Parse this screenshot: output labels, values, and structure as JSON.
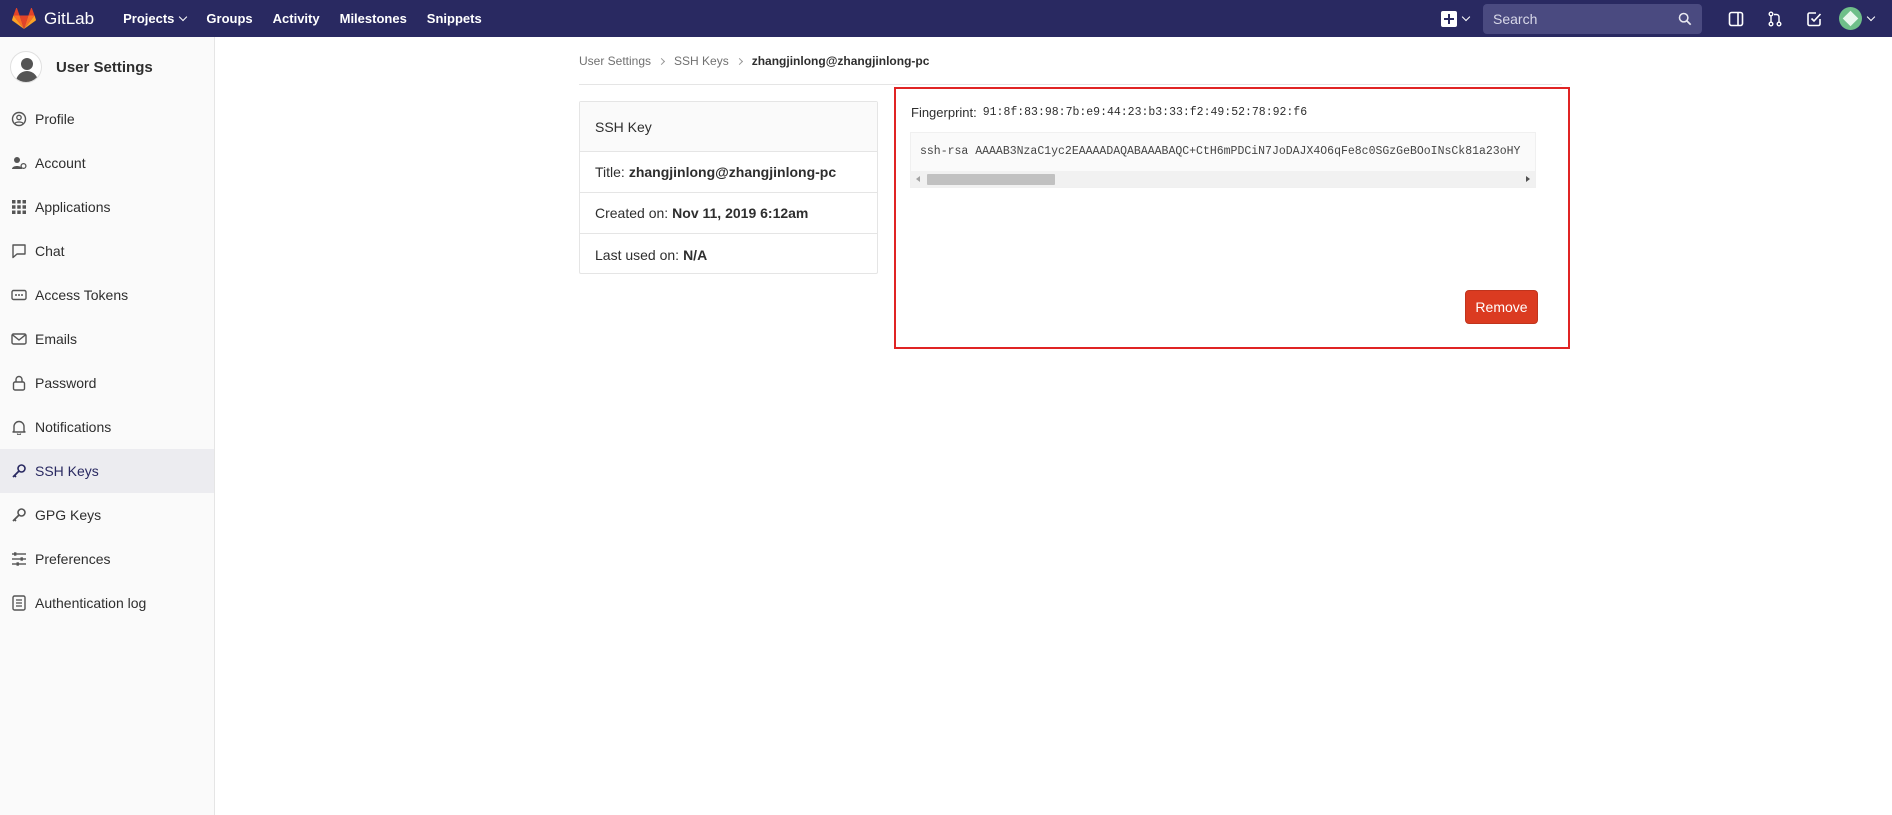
{
  "app": {
    "brand": "GitLab",
    "accent_color": "#292961",
    "danger_color": "#db3b21",
    "highlight_color": "#e02424"
  },
  "navbar": {
    "links": [
      {
        "label": "Projects",
        "has_dropdown": true
      },
      {
        "label": "Groups"
      },
      {
        "label": "Activity"
      },
      {
        "label": "Milestones"
      },
      {
        "label": "Snippets"
      }
    ],
    "search_placeholder": "Search",
    "icons": [
      "plus-icon",
      "search-icon",
      "sidebar-toggle-icon",
      "merge-request-icon",
      "todo-check-icon",
      "user-avatar"
    ]
  },
  "sidebar": {
    "title": "User Settings",
    "items": [
      {
        "label": "Profile",
        "icon": "profile-icon"
      },
      {
        "label": "Account",
        "icon": "account-icon"
      },
      {
        "label": "Applications",
        "icon": "applications-icon"
      },
      {
        "label": "Chat",
        "icon": "chat-icon"
      },
      {
        "label": "Access Tokens",
        "icon": "access-tokens-icon"
      },
      {
        "label": "Emails",
        "icon": "email-icon"
      },
      {
        "label": "Password",
        "icon": "lock-icon"
      },
      {
        "label": "Notifications",
        "icon": "bell-icon"
      },
      {
        "label": "SSH Keys",
        "icon": "key-icon",
        "active": true
      },
      {
        "label": "GPG Keys",
        "icon": "key-icon"
      },
      {
        "label": "Preferences",
        "icon": "preferences-icon"
      },
      {
        "label": "Authentication log",
        "icon": "log-icon"
      }
    ]
  },
  "breadcrumb": {
    "items": [
      "User Settings",
      "SSH Keys"
    ],
    "current": "zhangjinlong@zhangjinlong-pc"
  },
  "key_card": {
    "header": "SSH Key",
    "title_label": "Title:",
    "title_value": "zhangjinlong@zhangjinlong-pc",
    "created_label": "Created on:",
    "created_value": "Nov 11, 2019 6:12am",
    "last_used_label": "Last used on:",
    "last_used_value": "N/A"
  },
  "key_detail": {
    "fingerprint_label": "Fingerprint:",
    "fingerprint_value": "91:8f:83:98:7b:e9:44:23:b3:33:f2:49:52:78:92:f6",
    "key_text": "ssh-rsa AAAAB3NzaC1yc2EAAAADAQABAAABAQC+CtH6mPDCiN7JoDAJX4O6qFe8c0SGzGeBOoINsCk81a23oHY",
    "remove_label": "Remove"
  }
}
